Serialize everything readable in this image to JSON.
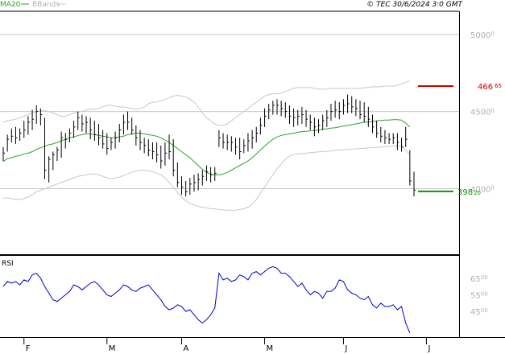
{
  "header": {
    "legend_ma": "MA20",
    "legend_bb": "BBands",
    "copyright": "© TEC 30/6/2024 3:0 GMT"
  },
  "rsi_label": "RSI",
  "colors": {
    "price": "#000000",
    "ma": "#2aa52a",
    "bands": "#c8c8c8",
    "rsi": "#0000cc",
    "grid": "#c8c8c8",
    "resistance": "#cc0000",
    "support": "#009900"
  },
  "chart_data": [
    {
      "type": "ohlc",
      "y_ticks": [
        {
          "value": 5000,
          "main": "5000",
          "sub": "0"
        },
        {
          "value": 4500,
          "main": "4500",
          "sub": "0"
        },
        {
          "value": 4000,
          "main": "4000",
          "sub": "0"
        }
      ],
      "ylim": [
        3580,
        5150
      ],
      "x_labels": [
        "F",
        "M",
        "A",
        "M",
        "J",
        "J"
      ],
      "levels": {
        "resistance": {
          "value": 4665,
          "main": "466",
          "sub": "65"
        },
        "support": {
          "value": 3982,
          "main": "398",
          "sub": "20"
        }
      },
      "bars": [
        [
          4270,
          4180,
          4230
        ],
        [
          4350,
          4240,
          4320
        ],
        [
          4390,
          4300,
          4340
        ],
        [
          4400,
          4290,
          4330
        ],
        [
          4390,
          4310,
          4360
        ],
        [
          4440,
          4330,
          4380
        ],
        [
          4470,
          4350,
          4430
        ],
        [
          4510,
          4380,
          4450
        ],
        [
          4540,
          4420,
          4500
        ],
        [
          4520,
          4410,
          4480
        ],
        [
          4460,
          4060,
          4120
        ],
        [
          4210,
          4040,
          4190
        ],
        [
          4240,
          4120,
          4220
        ],
        [
          4270,
          4180,
          4250
        ],
        [
          4370,
          4200,
          4330
        ],
        [
          4360,
          4260,
          4320
        ],
        [
          4390,
          4300,
          4360
        ],
        [
          4440,
          4330,
          4400
        ],
        [
          4500,
          4380,
          4460
        ],
        [
          4480,
          4370,
          4420
        ],
        [
          4470,
          4360,
          4430
        ],
        [
          4460,
          4320,
          4380
        ],
        [
          4440,
          4310,
          4350
        ],
        [
          4420,
          4280,
          4330
        ],
        [
          4380,
          4260,
          4290
        ],
        [
          4360,
          4220,
          4260
        ],
        [
          4330,
          4250,
          4300
        ],
        [
          4370,
          4260,
          4330
        ],
        [
          4420,
          4300,
          4380
        ],
        [
          4480,
          4350,
          4430
        ],
        [
          4500,
          4380,
          4430
        ],
        [
          4460,
          4350,
          4380
        ],
        [
          4410,
          4280,
          4330
        ],
        [
          4380,
          4250,
          4300
        ],
        [
          4330,
          4230,
          4280
        ],
        [
          4320,
          4210,
          4250
        ],
        [
          4300,
          4190,
          4240
        ],
        [
          4300,
          4170,
          4220
        ],
        [
          4280,
          4130,
          4180
        ],
        [
          4300,
          4150,
          4230
        ],
        [
          4350,
          4190,
          4240
        ],
        [
          4320,
          4080,
          4120
        ],
        [
          4170,
          4010,
          4040
        ],
        [
          4080,
          3960,
          4010
        ],
        [
          4050,
          3950,
          3980
        ],
        [
          4070,
          3960,
          4030
        ],
        [
          4090,
          3980,
          4040
        ],
        [
          4100,
          3990,
          4060
        ],
        [
          4120,
          4020,
          4080
        ],
        [
          4150,
          4050,
          4110
        ],
        [
          4140,
          4040,
          4090
        ],
        [
          4140,
          4050,
          4100
        ],
        [
          4380,
          4270,
          4330
        ],
        [
          4360,
          4260,
          4300
        ],
        [
          4350,
          4250,
          4300
        ],
        [
          4340,
          4240,
          4300
        ],
        [
          4330,
          4220,
          4270
        ],
        [
          4330,
          4190,
          4240
        ],
        [
          4320,
          4230,
          4280
        ],
        [
          4360,
          4240,
          4310
        ],
        [
          4380,
          4260,
          4330
        ],
        [
          4400,
          4300,
          4360
        ],
        [
          4460,
          4350,
          4410
        ],
        [
          4520,
          4400,
          4470
        ],
        [
          4550,
          4450,
          4510
        ],
        [
          4570,
          4480,
          4540
        ],
        [
          4580,
          4480,
          4540
        ],
        [
          4570,
          4470,
          4520
        ],
        [
          4560,
          4460,
          4500
        ],
        [
          4540,
          4420,
          4470
        ],
        [
          4520,
          4400,
          4460
        ],
        [
          4510,
          4410,
          4470
        ],
        [
          4530,
          4420,
          4480
        ],
        [
          4510,
          4400,
          4450
        ],
        [
          4480,
          4380,
          4430
        ],
        [
          4460,
          4340,
          4400
        ],
        [
          4450,
          4360,
          4410
        ],
        [
          4480,
          4380,
          4440
        ],
        [
          4510,
          4400,
          4460
        ],
        [
          4550,
          4440,
          4500
        ],
        [
          4570,
          4460,
          4510
        ],
        [
          4560,
          4450,
          4500
        ],
        [
          4580,
          4480,
          4540
        ],
        [
          4610,
          4490,
          4550
        ],
        [
          4600,
          4490,
          4530
        ],
        [
          4580,
          4470,
          4520
        ],
        [
          4570,
          4450,
          4480
        ],
        [
          4560,
          4430,
          4470
        ],
        [
          4530,
          4400,
          4450
        ],
        [
          4480,
          4360,
          4400
        ],
        [
          4440,
          4330,
          4360
        ],
        [
          4400,
          4300,
          4340
        ],
        [
          4380,
          4290,
          4330
        ],
        [
          4360,
          4290,
          4320
        ],
        [
          4360,
          4290,
          4330
        ],
        [
          4360,
          4250,
          4300
        ],
        [
          4330,
          4240,
          4270
        ],
        [
          4400,
          4270,
          4320
        ],
        [
          4250,
          4020,
          4050
        ],
        [
          4110,
          3950,
          3990
        ]
      ],
      "ma": [
        4175,
        4195,
        4200,
        4210,
        4215,
        4225,
        4230,
        4240,
        4255,
        4265,
        4275,
        4285,
        4290,
        4300,
        4310,
        4320,
        4330,
        4335,
        4345,
        4350,
        4355,
        4355,
        4350,
        4345,
        4340,
        4335,
        4330,
        4330,
        4335,
        4340,
        4350,
        4355,
        4360,
        4360,
        4355,
        4350,
        4345,
        4340,
        4330,
        4315,
        4300,
        4280,
        4260,
        4240,
        4220,
        4200,
        4175,
        4150,
        4125,
        4105,
        4095,
        4090,
        4090,
        4095,
        4105,
        4120,
        4135,
        4150,
        4165,
        4180,
        4200,
        4225,
        4250,
        4275,
        4300,
        4320,
        4335,
        4345,
        4350,
        4355,
        4360,
        4365,
        4370,
        4372,
        4375,
        4378,
        4380,
        4385,
        4388,
        4392,
        4395,
        4400,
        4405,
        4410,
        4415,
        4420,
        4425,
        4430,
        4432,
        4435,
        4440,
        4442,
        4445,
        4445,
        4447,
        4447,
        4445,
        4425,
        4400
      ],
      "bb_upper": [
        4430,
        4440,
        4445,
        4450,
        4460,
        4470,
        4480,
        4490,
        4500,
        4505,
        4505,
        4500,
        4490,
        4480,
        4470,
        4470,
        4480,
        4490,
        4495,
        4500,
        4510,
        4515,
        4515,
        4520,
        4530,
        4540,
        4540,
        4535,
        4530,
        4530,
        4525,
        4520,
        4515,
        4520,
        4530,
        4550,
        4560,
        4560,
        4570,
        4580,
        4590,
        4600,
        4605,
        4600,
        4595,
        4580,
        4560,
        4530,
        4490,
        4460,
        4440,
        4420,
        4410,
        4410,
        4420,
        4440,
        4460,
        4480,
        4500,
        4520,
        4540,
        4560,
        4580,
        4600,
        4610,
        4615,
        4615,
        4620,
        4630,
        4640,
        4650,
        4655,
        4655,
        4655,
        4655,
        4650,
        4645,
        4645,
        4645,
        4650,
        4650,
        4650,
        4650,
        4650,
        4650,
        4650,
        4650,
        4655,
        4655,
        4660,
        4660,
        4660,
        4665,
        4665,
        4665,
        4670,
        4680,
        4690,
        4700
      ],
      "bb_lower": [
        3940,
        3940,
        3935,
        3930,
        3930,
        3935,
        3945,
        3960,
        3980,
        3990,
        4000,
        4010,
        4020,
        4030,
        4040,
        4050,
        4060,
        4070,
        4080,
        4085,
        4090,
        4095,
        4095,
        4090,
        4080,
        4070,
        4065,
        4070,
        4075,
        4085,
        4095,
        4105,
        4115,
        4120,
        4120,
        4115,
        4110,
        4100,
        4090,
        4070,
        4040,
        4010,
        3975,
        3945,
        3920,
        3905,
        3895,
        3885,
        3880,
        3875,
        3870,
        3868,
        3865,
        3862,
        3860,
        3860,
        3860,
        3865,
        3870,
        3880,
        3900,
        3930,
        3970,
        4010,
        4050,
        4090,
        4130,
        4160,
        4190,
        4210,
        4220,
        4225,
        4228,
        4230,
        4233,
        4236,
        4238,
        4240,
        4242,
        4245,
        4248,
        4250,
        4252,
        4254,
        4256,
        4258,
        4260,
        4262,
        4264,
        4266,
        4268,
        4270,
        4272,
        4274,
        4276,
        4278,
        4278,
        4250,
        4220
      ]
    },
    {
      "type": "line",
      "title": "RSI",
      "y_ticks": [
        {
          "value": 65,
          "main": "65",
          "sub": "00"
        },
        {
          "value": 55,
          "main": "55",
          "sub": "00"
        },
        {
          "value": 45,
          "main": "45",
          "sub": "00"
        }
      ],
      "ylim": [
        30,
        78
      ],
      "values": [
        60,
        63,
        62,
        63,
        61,
        64,
        63,
        67,
        68,
        65,
        60,
        56,
        52,
        51,
        53,
        55,
        57,
        61,
        60,
        58,
        60,
        62,
        63,
        61,
        58,
        55,
        54,
        56,
        58,
        61,
        60,
        58,
        57,
        59,
        60,
        61,
        58,
        55,
        52,
        48,
        46,
        47,
        49,
        48,
        45,
        46,
        43,
        40,
        38,
        40,
        43,
        47,
        68,
        64,
        65,
        63,
        64,
        67,
        66,
        64,
        68,
        69,
        67,
        69,
        71,
        72,
        71,
        68,
        68,
        66,
        63,
        60,
        62,
        58,
        55,
        57,
        56,
        53,
        57,
        57,
        59,
        64,
        63,
        58,
        56,
        55,
        53,
        52,
        54,
        49,
        47,
        50,
        48,
        48,
        49,
        46,
        48,
        38,
        32
      ]
    }
  ]
}
